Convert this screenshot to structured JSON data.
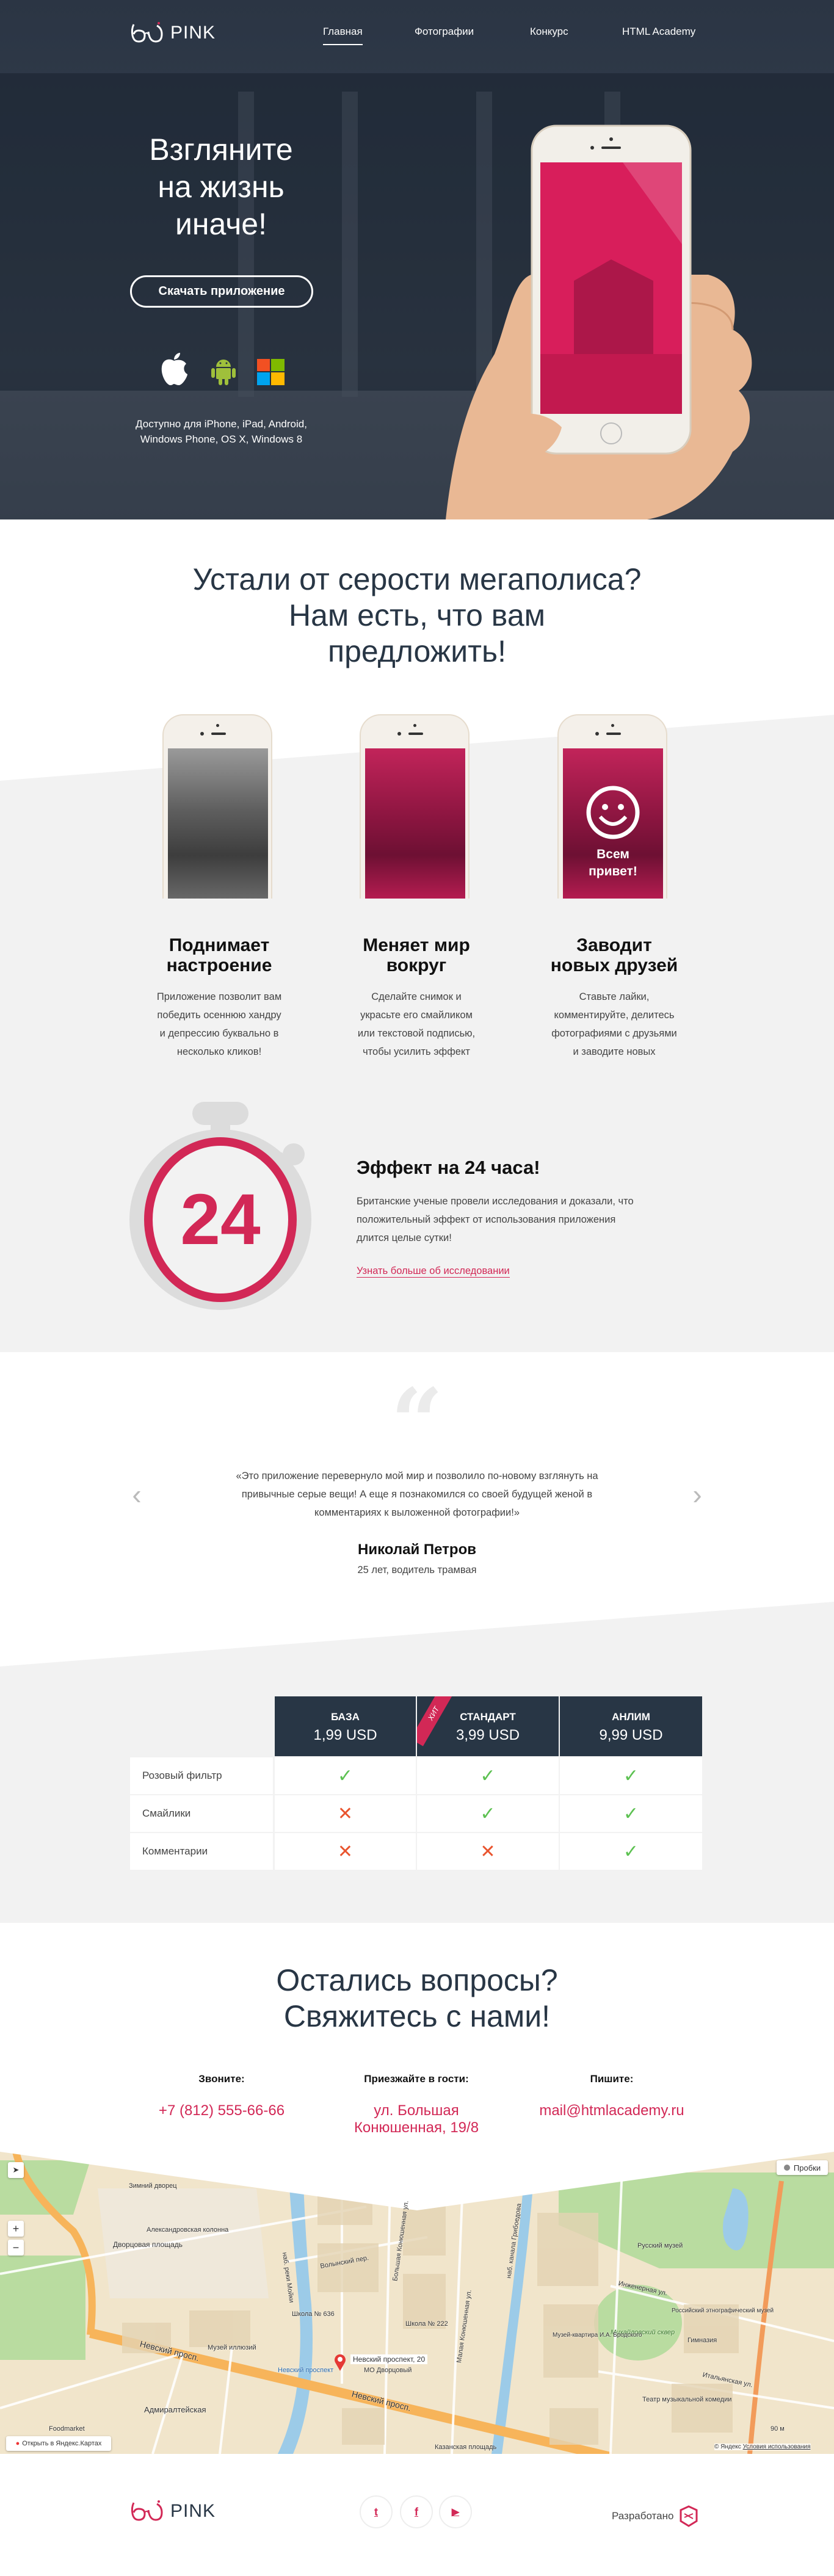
{
  "colors": {
    "brand": "#d22856",
    "navy": "#283645",
    "gray_bg": "#f2f2f2",
    "check": "#5cc151",
    "cross": "#e9542e"
  },
  "header": {
    "logo_text": "PINK",
    "nav": [
      {
        "label": "Главная",
        "active": true
      },
      {
        "label": "Фотографии"
      },
      {
        "label": "Конкурс"
      },
      {
        "label": "HTML Academy"
      }
    ]
  },
  "hero": {
    "title_lines": [
      "Взгляните",
      "на жизнь",
      "иначе!"
    ],
    "download_button": "Скачать приложение",
    "platform_icons": [
      "apple-icon",
      "android-icon",
      "windows-icon"
    ],
    "available_lines": [
      "Доступно для iPhone, iPad, Android,",
      "Windows Phone, OS X, Windows 8"
    ]
  },
  "intro": {
    "title_lines": [
      "Устали от серости мегаполиса?",
      "Нам есть, что вам",
      "предложить!"
    ],
    "phone3_overlay_lines": [
      "Всем",
      "привет!"
    ],
    "features": [
      {
        "title_lines": [
          "Поднимает",
          "настроение"
        ],
        "text_lines": [
          "Приложение позволит вам",
          "победить осеннюю хандру",
          "и депрессию буквально в",
          "несколько кликов!"
        ]
      },
      {
        "title_lines": [
          "Меняет мир",
          "вокруг"
        ],
        "text_lines": [
          "Сделайте снимок и",
          "украсьте его смайликом",
          "или текстовой подписью,",
          "чтобы усилить эффект"
        ]
      },
      {
        "title_lines": [
          "Заводит",
          "новых друзей"
        ],
        "text_lines": [
          "Ставьте лайки,",
          "комментируйте, делитесь",
          "фотографиями с друзьями",
          "и заводите новых"
        ]
      }
    ]
  },
  "effect": {
    "number": "24",
    "title": "Эффект на 24 часа!",
    "text_lines": [
      "Британские ученые провели исследования и доказали, что",
      "положительный эффект от использования приложения",
      "длится целые сутки!"
    ],
    "link": "Узнать больше об исследовании"
  },
  "review": {
    "quote_mark": "“",
    "text_lines": [
      "«Это приложение перевернуло мой мир и позволило по-новому взглянуть на",
      "привычные серые вещи! А еще я познакомился со своей будущей женой в",
      "комментариях к выложенной фотографии!»"
    ],
    "name": "Николай Петров",
    "subtitle": "25 лет, водитель трамвая",
    "prev": "‹",
    "next": "›"
  },
  "pricing": {
    "badge": "ХИТ",
    "plans": [
      {
        "name": "БАЗА",
        "price": "1,99 USD"
      },
      {
        "name": "СТАНДАРТ",
        "price": "3,99 USD"
      },
      {
        "name": "АНЛИМ",
        "price": "9,99 USD"
      }
    ],
    "rows": [
      {
        "label": "Розовый фильтр",
        "values": [
          true,
          true,
          true
        ]
      },
      {
        "label": "Смайлики",
        "values": [
          false,
          true,
          true
        ]
      },
      {
        "label": "Комментарии",
        "values": [
          false,
          false,
          true
        ]
      }
    ]
  },
  "contacts": {
    "title_lines": [
      "Остались вопросы?",
      "Свяжитесь с нами!"
    ],
    "items": [
      {
        "label": "Звоните:",
        "value_lines": [
          "+7 (812) 555-66-66"
        ]
      },
      {
        "label": "Приезжайте в гости:",
        "value_lines": [
          "ул. Большая",
          "Конюшенная, 19/8"
        ]
      },
      {
        "label": "Пишите:",
        "value_lines": [
          "mail@htmlacademy.ru"
        ]
      }
    ]
  },
  "map": {
    "traffic": "Пробки",
    "open_link": "Открыть в Яндекс.Картах",
    "marker_title": "Невский проспект, 20",
    "marker_sub": "МО Дворцовый",
    "copyright": "© Яндекс",
    "terms": "Условия использования",
    "scale": "90 м",
    "zoom_in": "+",
    "zoom_out": "−",
    "labels": {
      "winter_palace": "Зимний дворец",
      "alex_column": "Александровская колонна",
      "palace_square": "Дворцовая площадь",
      "volynsky": "Волынский пер.",
      "school636": "Школа № 636",
      "school222": "Школа № 222",
      "illusions": "Музей иллюзий",
      "nevsky1": "Невский просп.",
      "nevsky2": "Невский просп.",
      "admiralteyskaya": "Адмиралтейская",
      "kazan": "Казанская площадь",
      "mikh_square": "Михайловский сквер",
      "russian_museum": "Русский музей",
      "inzhenernaya": "Инженерная ул.",
      "theatre": "Театр музыкальной комедии",
      "italyanskaya": "Итальянская ул.",
      "moika": "наб. реки Мойки",
      "griboedova": "наб. канала Грибоедова",
      "nevsky_metro": "Невский проспект",
      "b_konyush": "Большая Конюшенная ул.",
      "m_konyush": "Малая Конюшенная ул.",
      "ethno": "Российский этнографический музей",
      "foodmarket": "Foodmarket",
      "gymnasium": "Гимназия",
      "brodsky": "Музей-квартира И.А. Бродского"
    }
  },
  "footer": {
    "logo_text": "PINK",
    "social": [
      {
        "icon": "twitter-icon",
        "glyph": "t"
      },
      {
        "icon": "facebook-icon",
        "glyph": "f"
      },
      {
        "icon": "youtube-icon",
        "glyph": "▶"
      }
    ],
    "made_by": "Разработано"
  }
}
